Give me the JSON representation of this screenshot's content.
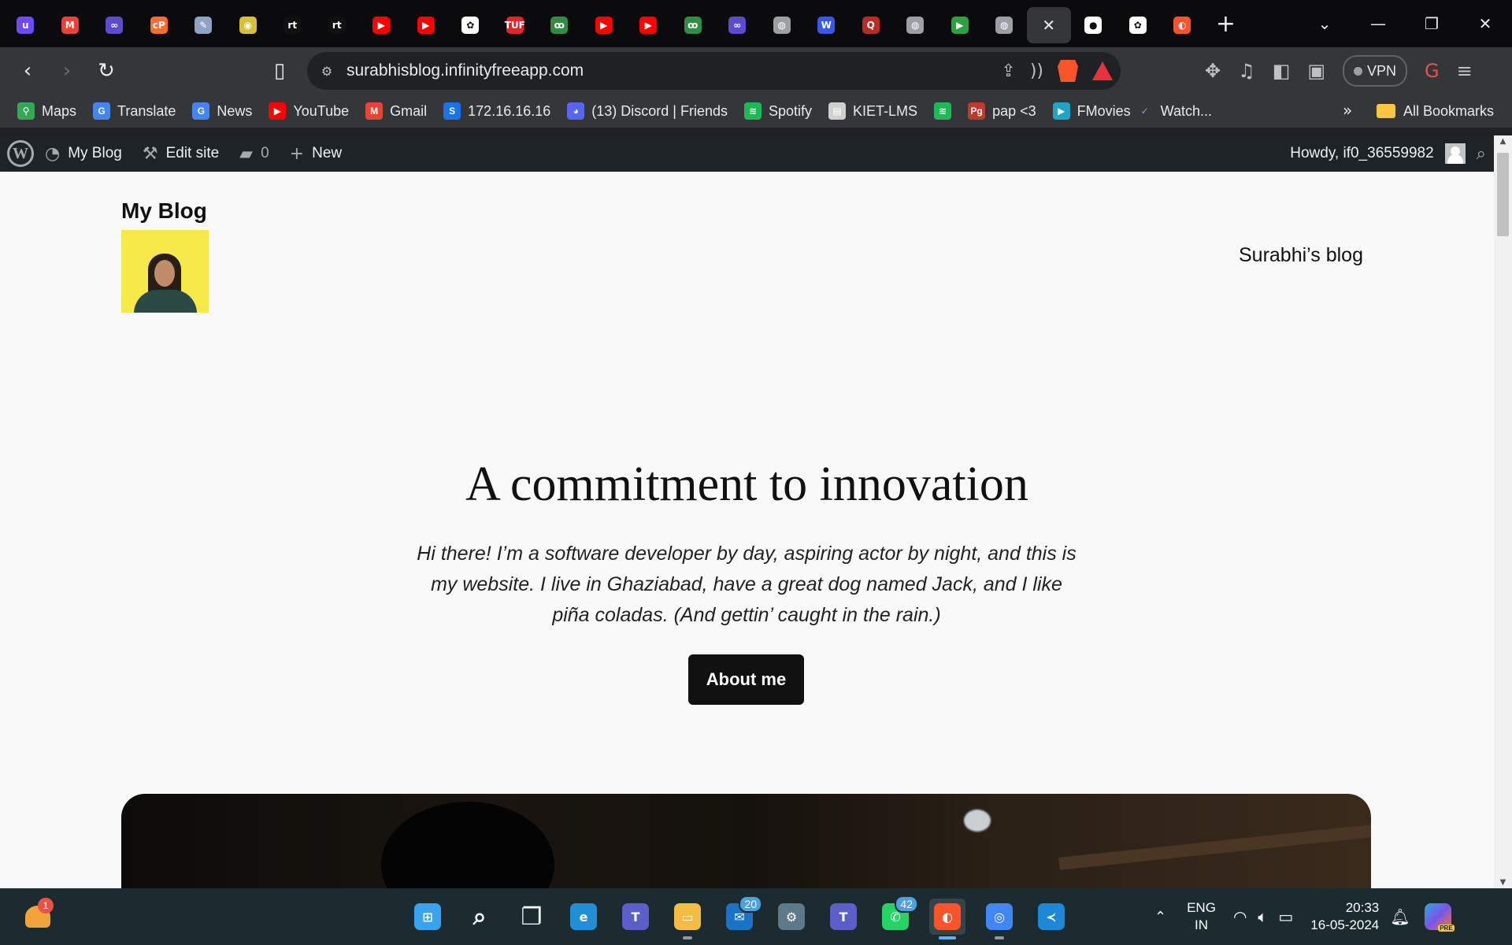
{
  "browser": {
    "tabs": [
      {
        "icon": "proton-icon",
        "color": "#6d4aff",
        "glyph": "u"
      },
      {
        "icon": "gmail-icon",
        "color": "#ea4335",
        "glyph": "M"
      },
      {
        "icon": "infinity-icon",
        "color": "#5a4bd1",
        "glyph": "∞"
      },
      {
        "icon": "cpanel-icon",
        "color": "#ff6c2c",
        "glyph": "cP"
      },
      {
        "icon": "draw-icon",
        "color": "#8fa4c4",
        "glyph": "✎"
      },
      {
        "icon": "owl-icon",
        "color": "#d6c23a",
        "glyph": "◉"
      },
      {
        "icon": "rt-icon",
        "color": "#111111",
        "glyph": "rt"
      },
      {
        "icon": "rt-icon",
        "color": "#111111",
        "glyph": "rt"
      },
      {
        "icon": "youtube-icon",
        "color": "#ff0000",
        "glyph": "▶"
      },
      {
        "icon": "youtube-icon",
        "color": "#ff0000",
        "glyph": "▶"
      },
      {
        "icon": "chatgpt-icon",
        "color": "#ffffff",
        "glyph": "✿"
      },
      {
        "icon": "tuf-icon",
        "color": "#e0262b",
        "glyph": "TUF"
      },
      {
        "icon": "geeksforgeeks-icon",
        "color": "#2f8d46",
        "glyph": "ꝏ"
      },
      {
        "icon": "youtube-icon",
        "color": "#ff0000",
        "glyph": "▶"
      },
      {
        "icon": "youtube-icon",
        "color": "#ff0000",
        "glyph": "▶"
      },
      {
        "icon": "geeksforgeeks-icon",
        "color": "#2f8d46",
        "glyph": "ꝏ"
      },
      {
        "icon": "infinity-icon",
        "color": "#5a4bd1",
        "glyph": "∞"
      },
      {
        "icon": "globe-icon",
        "color": "#9aa0a6",
        "glyph": "◍"
      },
      {
        "icon": "wordpress-icon",
        "color": "#3858e9",
        "glyph": "W"
      },
      {
        "icon": "quora-icon",
        "color": "#b92b27",
        "glyph": "Q"
      },
      {
        "icon": "globe-icon",
        "color": "#9aa0a6",
        "glyph": "◍"
      },
      {
        "icon": "shield-icon",
        "color": "#2ea043",
        "glyph": "▶"
      },
      {
        "icon": "globe-icon",
        "color": "#9aa0a6",
        "glyph": "◍"
      },
      {
        "icon": "close-icon",
        "color": "#35363a",
        "glyph": "✕",
        "active": true
      },
      {
        "icon": "github-icon",
        "color": "#ffffff",
        "glyph": "●"
      },
      {
        "icon": "chatgpt-icon",
        "color": "#ffffff",
        "glyph": "✿"
      },
      {
        "icon": "brave-icon",
        "color": "#fb542b",
        "glyph": "◐"
      }
    ],
    "url": "surabhisblog.infinityfreeapp.com",
    "vpn_label": "VPN",
    "bookmarks": [
      {
        "label": "Maps",
        "icon": "maps-icon",
        "color": "#34a853",
        "glyph": "⚲"
      },
      {
        "label": "Translate",
        "icon": "translate-icon",
        "color": "#4285f4",
        "glyph": "G"
      },
      {
        "label": "News",
        "icon": "news-icon",
        "color": "#4285f4",
        "glyph": "G"
      },
      {
        "label": "YouTube",
        "icon": "youtube-icon",
        "color": "#ff0000",
        "glyph": "▶"
      },
      {
        "label": "Gmail",
        "icon": "gmail-icon",
        "color": "#ea4335",
        "glyph": "M"
      },
      {
        "label": "172.16.16.16",
        "icon": "s-icon",
        "color": "#1a73e8",
        "glyph": "S"
      },
      {
        "label": "(13) Discord | Friends",
        "icon": "discord-icon",
        "color": "#5865f2",
        "glyph": "◕"
      },
      {
        "label": "Spotify",
        "icon": "spotify-icon",
        "color": "#1db954",
        "glyph": "≋"
      },
      {
        "label": "KIET-LMS",
        "icon": "kiet-icon",
        "color": "#d0d0d0",
        "glyph": "▤"
      },
      {
        "label": "",
        "icon": "spotify-icon",
        "color": "#1db954",
        "glyph": "≋"
      },
      {
        "label": "pap <3",
        "icon": "pg-icon",
        "color": "#c0392b",
        "glyph": "Pg"
      },
      {
        "label": "FMovies",
        "icon": "play-icon",
        "color": "#1fa3c8",
        "glyph": "▶"
      },
      {
        "label": "Watch...",
        "icon": "check-icon",
        "color": "#35363a",
        "glyph": "✓"
      }
    ],
    "bookmarks_overflow": "»",
    "all_bookmarks": "All Bookmarks"
  },
  "wp_admin_bar": {
    "site_name": "My Blog",
    "edit_site": "Edit site",
    "comments_count": "0",
    "new_label": "New",
    "howdy": "Howdy, if0_36559982"
  },
  "site": {
    "title": "My Blog",
    "nav_link": "Surabhi’s blog",
    "hero_heading": "A commitment to innovation",
    "hero_text": "Hi there! I’m a software developer by day, aspiring actor by night, and this is my website. I live in Ghaziabad, have a great dog named Jack, and I like piña coladas. (And gettin’ caught in the rain.)",
    "button_label": "About me"
  },
  "taskbar": {
    "weather_badge": "1",
    "apps": [
      {
        "icon": "windows-start-icon",
        "color": "#3aa3f0",
        "glyph": "⊞"
      },
      {
        "icon": "search-icon",
        "color": "#1c2b30",
        "glyph": "⌕"
      },
      {
        "icon": "task-view-icon",
        "color": "#1c2b30",
        "glyph": "❐"
      },
      {
        "icon": "edge-icon",
        "color": "#1f8fd6",
        "glyph": "e"
      },
      {
        "icon": "teams-icon",
        "color": "#5b5fc7",
        "glyph": "T"
      },
      {
        "icon": "file-explorer-icon",
        "color": "#f2bd42",
        "glyph": "▭",
        "running": true
      },
      {
        "icon": "mail-icon",
        "color": "#1b73c4",
        "glyph": "✉",
        "badge": "20"
      },
      {
        "icon": "settings-icon",
        "color": "#5d7a8a",
        "glyph": "⚙"
      },
      {
        "icon": "teams-new-icon",
        "color": "#5b5fc7",
        "glyph": "T"
      },
      {
        "icon": "whatsapp-icon",
        "color": "#25d366",
        "glyph": "✆",
        "badge": "42"
      },
      {
        "icon": "brave-icon",
        "color": "#fb542b",
        "glyph": "◐",
        "active": true,
        "running": true
      },
      {
        "icon": "chrome-icon",
        "color": "#4285f4",
        "glyph": "◎",
        "running": true
      },
      {
        "icon": "vscode-icon",
        "color": "#1e88d6",
        "glyph": "≺"
      }
    ],
    "lang_top": "ENG",
    "lang_bottom": "IN",
    "time": "20:33",
    "date": "16-05-2024"
  }
}
